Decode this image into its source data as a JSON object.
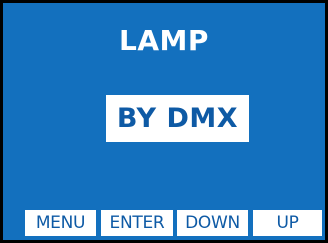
{
  "screen": {
    "title": "LAMP",
    "value": "BY DMX",
    "background_color": "#1370be",
    "text_color": "#0e5aa5"
  },
  "softkeys": {
    "menu": "MENU",
    "enter": "ENTER",
    "down": "DOWN",
    "up": "UP"
  }
}
